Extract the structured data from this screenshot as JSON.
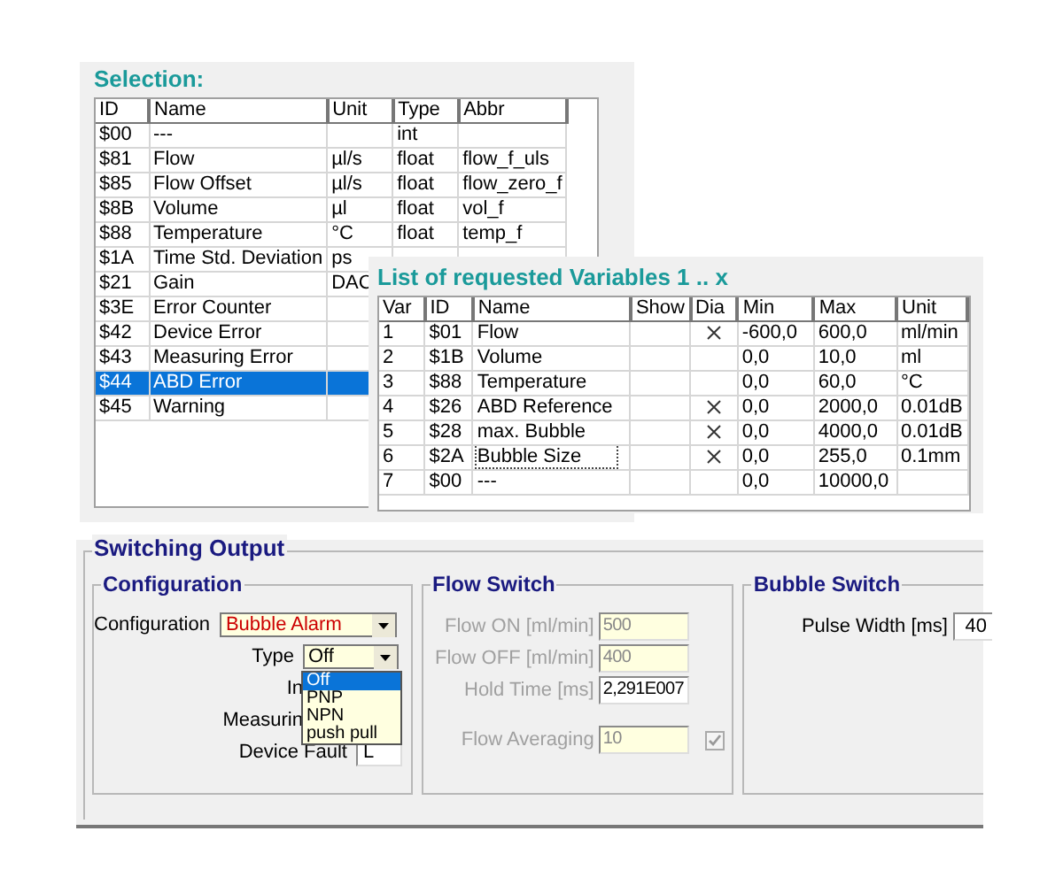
{
  "selection": {
    "title": "Selection:",
    "columns": [
      "ID",
      "Name",
      "Unit",
      "Type",
      "Abbr"
    ],
    "rows": [
      {
        "cells": [
          "$00",
          "---",
          "",
          "int",
          ""
        ],
        "selected": false
      },
      {
        "cells": [
          "$81",
          "Flow",
          "µl/s",
          "float",
          "flow_f_uls"
        ],
        "selected": false
      },
      {
        "cells": [
          "$85",
          "Flow Offset",
          "µl/s",
          "float",
          "flow_zero_f"
        ],
        "selected": false
      },
      {
        "cells": [
          "$8B",
          "Volume",
          "µl",
          "float",
          "vol_f"
        ],
        "selected": false
      },
      {
        "cells": [
          "$88",
          "Temperature",
          "°C",
          "float",
          "temp_f"
        ],
        "selected": false
      },
      {
        "cells": [
          "$1A",
          "Time Std. Deviation",
          "ps"
        ],
        "selected": false
      },
      {
        "cells": [
          "$21",
          "Gain",
          "DAC"
        ],
        "selected": false
      },
      {
        "cells": [
          "$3E",
          "Error Counter",
          ""
        ],
        "selected": false
      },
      {
        "cells": [
          "$42",
          "Device Error",
          ""
        ],
        "selected": false
      },
      {
        "cells": [
          "$43",
          "Measuring Error",
          ""
        ],
        "selected": false
      },
      {
        "cells": [
          "$44",
          "ABD Error",
          ""
        ],
        "selected": true
      },
      {
        "cells": [
          "$45",
          "Warning",
          ""
        ],
        "selected": false
      }
    ]
  },
  "requested_variables": {
    "title": "List of requested Variables 1 .. x",
    "columns": [
      "Var",
      "ID",
      "Name",
      "Show",
      "Dia",
      "Min",
      "Max",
      "Unit"
    ],
    "rows": [
      {
        "var": "1",
        "id": "$01",
        "name": "Flow",
        "dia": true,
        "min": "-600,0",
        "max": "600,0",
        "unit": "ml/min",
        "focused": false
      },
      {
        "var": "2",
        "id": "$1B",
        "name": "Volume",
        "dia": false,
        "min": "0,0",
        "max": "10,0",
        "unit": "ml",
        "focused": false
      },
      {
        "var": "3",
        "id": "$88",
        "name": "Temperature",
        "dia": false,
        "min": "0,0",
        "max": "60,0",
        "unit": "°C",
        "focused": false
      },
      {
        "var": "4",
        "id": "$26",
        "name": "ABD Reference",
        "dia": true,
        "min": "0,0",
        "max": "2000,0",
        "unit": "0.01dB",
        "focused": false
      },
      {
        "var": "5",
        "id": "$28",
        "name": "max. Bubble",
        "dia": true,
        "min": "0,0",
        "max": "4000,0",
        "unit": "0.01dB",
        "focused": false
      },
      {
        "var": "6",
        "id": "$2A",
        "name": "Bubble Size",
        "dia": true,
        "min": "0,0",
        "max": "255,0",
        "unit": "0.1mm",
        "focused": true
      },
      {
        "var": "7",
        "id": "$00",
        "name": "---",
        "dia": false,
        "min": "0,0",
        "max": "10000,0",
        "unit": "",
        "focused": false
      }
    ]
  },
  "switching_output": {
    "title": "Switching Output",
    "configuration": {
      "title": "Configuration",
      "fields": [
        {
          "kind": "combo",
          "label": "Configuration",
          "value": "Bubble Alarm"
        },
        {
          "kind": "combo",
          "label": "Type",
          "value": "Off"
        },
        {
          "kind": "label",
          "label": "In"
        },
        {
          "kind": "label",
          "label": "Measurin"
        },
        {
          "kind": "text",
          "label": "Device Fault",
          "value": "L"
        }
      ]
    },
    "type_dropdown": {
      "options": [
        {
          "label": "Off",
          "selected": true
        },
        {
          "label": "PNP",
          "selected": false
        },
        {
          "label": "NPN",
          "selected": false
        },
        {
          "label": "push pull",
          "selected": false
        }
      ]
    },
    "flow_switch": {
      "title": "Flow Switch",
      "disabled": true,
      "fields": [
        {
          "kind": "text",
          "label": "Flow ON [ml/min]",
          "value": "500",
          "disabled": true
        },
        {
          "kind": "text",
          "label": "Flow OFF [ml/min]",
          "value": "400",
          "disabled": true
        },
        {
          "kind": "text",
          "label": "Hold Time [ms]",
          "value": "2,291E007",
          "disabled": false
        },
        {
          "kind": "check",
          "label": "Flow Averaging",
          "value": "10",
          "disabled": true,
          "checked": true
        }
      ]
    },
    "bubble_switch": {
      "title": "Bubble Switch",
      "fields": [
        {
          "label": "Pulse Width [ms]",
          "value": "40"
        }
      ]
    }
  }
}
